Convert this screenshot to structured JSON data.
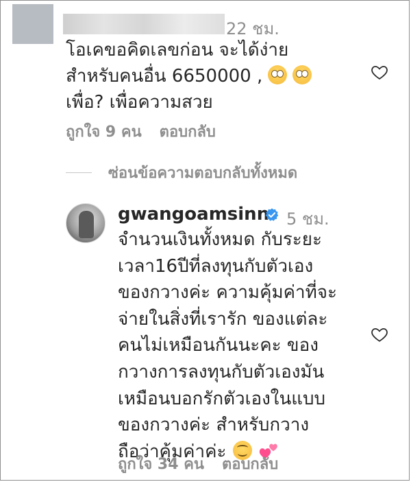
{
  "colors": {
    "text": "#262626",
    "muted": "#8e8e8e",
    "verified": "#3897f0",
    "heart_pink": "#ff4d8d"
  },
  "comment1": {
    "time": "22 ชม.",
    "lines": [
      "โอเคขอคิดเลขก่อน จะได้ง่าย",
      "สำหรับคนอื่น 6650000 ,",
      "เพื่อ? เพื่อความสวย"
    ],
    "emojis": [
      "face-with-rolling-eyes",
      "face-with-rolling-eyes"
    ],
    "likes": "ถูกใจ 9 คน",
    "reply": "ตอบกลับ"
  },
  "hide_replies": "ซ่อนข้อความตอบกลับทั้งหมด",
  "reply1": {
    "username": "gwangoamsinn",
    "time": "5 ชม.",
    "lines": [
      "จำนวนเงินทั้งหมด กับระยะ",
      "เวลา16ปีที่ลงทุนกับตัวเอง",
      "ของกวางค่ะ ความคุ้มค่าที่จะ",
      "จ่ายในสิ่งที่เรารัก ของแต่ละ",
      "คนไม่เหมือนกันนะคะ ของ",
      "กวางการลงทุนกับตัวเองมัน",
      "เหมือนบอกรักตัวเองในแบบ",
      "ของกวางค่ะ สำหรับกวาง",
      "ถือว่าคุ้มค่าค่ะ"
    ],
    "emojis": [
      "smiling-face-with-smiling-eyes",
      "two-hearts"
    ],
    "likes": "ถูกใจ 34 คน",
    "reply": "ตอบกลับ"
  }
}
